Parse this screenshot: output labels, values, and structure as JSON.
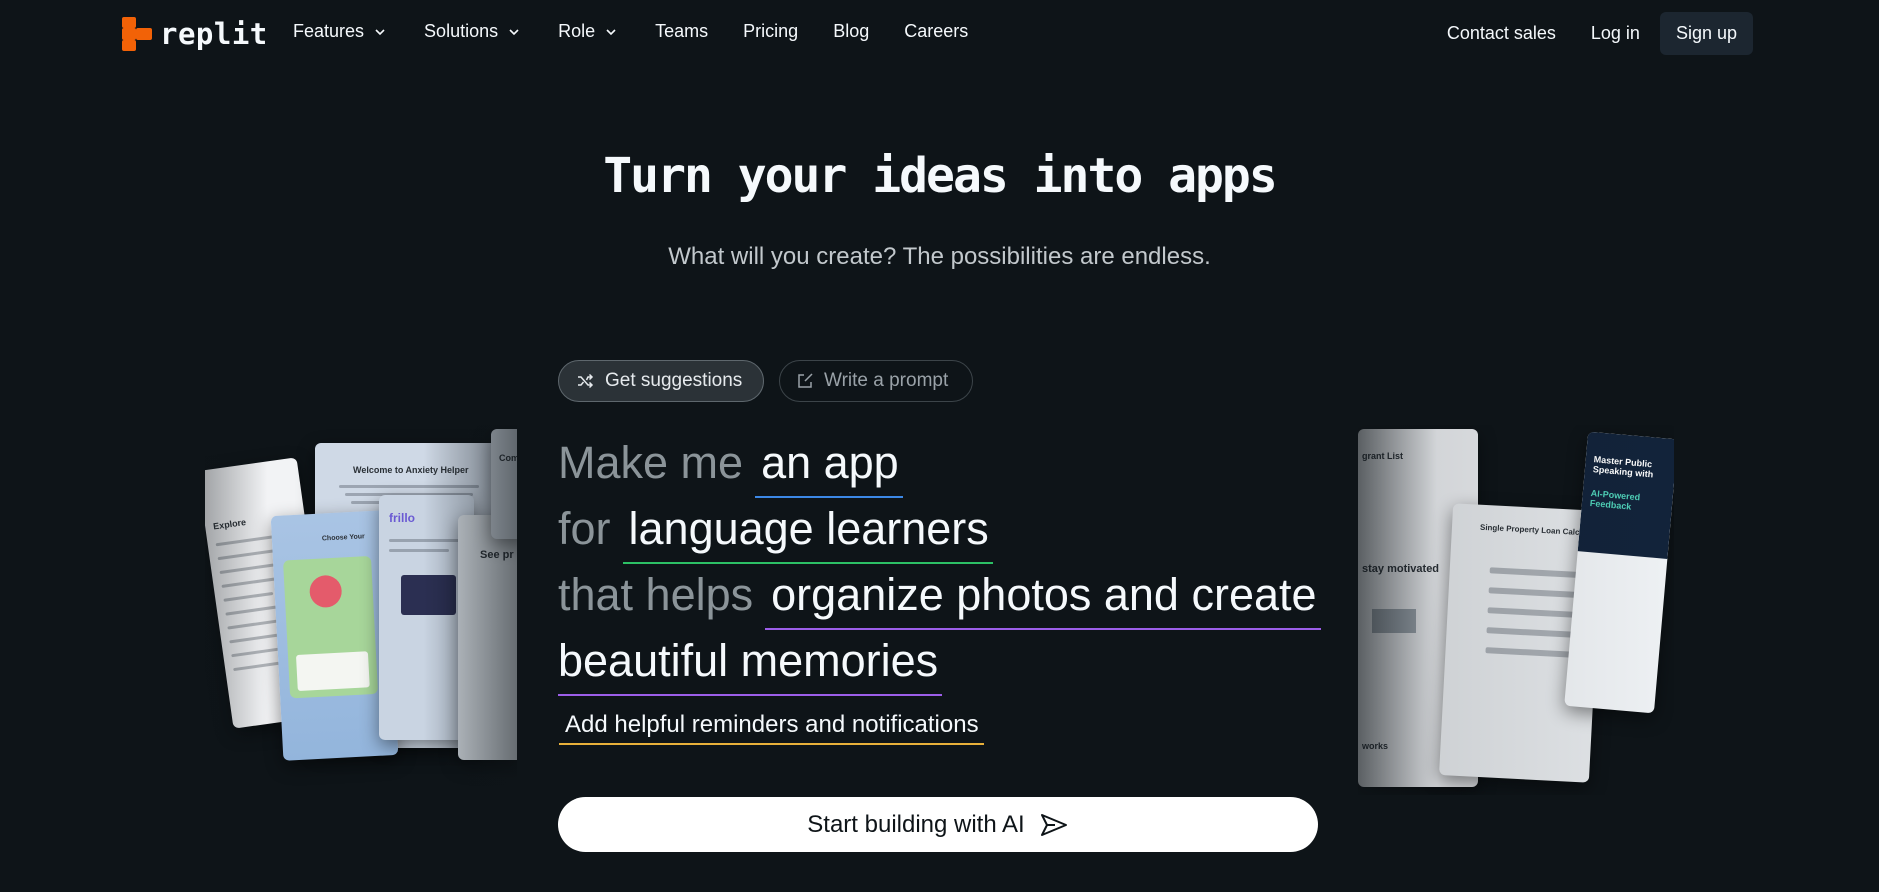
{
  "brand": {
    "name": "replit",
    "accent": "#f26207"
  },
  "nav": {
    "features": "Features",
    "solutions": "Solutions",
    "role": "Role",
    "teams": "Teams",
    "pricing": "Pricing",
    "blog": "Blog",
    "careers": "Careers",
    "contact": "Contact sales",
    "login": "Log in",
    "signup": "Sign up"
  },
  "hero": {
    "title": "Turn your ideas into apps",
    "subtitle": "What will you create? The possibilities are endless."
  },
  "modes": {
    "suggest": "Get suggestions",
    "write": "Write a prompt",
    "suggest_icon": "shuffle-icon",
    "write_icon": "edit-icon"
  },
  "prompt": {
    "line1_prefix": "Make me",
    "line1_value": "an app",
    "line2_prefix": "for",
    "line2_value": "language learners",
    "line3_prefix": "that helps",
    "line3_value": "organize photos and create",
    "line4_value": "beautiful memories",
    "extra": "Add helpful reminders and notifications",
    "colors": {
      "blue": "#3c88e6",
      "green": "#2cc065",
      "purple": "#9c5ee8",
      "yellow": "#e8b03a"
    }
  },
  "cta": {
    "label": "Start building with AI",
    "icon": "send-icon"
  },
  "showcase": {
    "left_cards": {
      "anxiety": "Welcome to Anxiety Helper",
      "choose": "Choose Your",
      "explore": "Explore",
      "frillo": "frillo",
      "see": "See pr",
      "comp": "Comp"
    },
    "right_cards": {
      "grant": "grant List",
      "motivated": "stay motivated",
      "loan": "Single Property Loan Calculator",
      "speaking_title": "Master Public Speaking with",
      "speaking_highlight": "AI-Powered Feedback",
      "works": "works"
    }
  }
}
